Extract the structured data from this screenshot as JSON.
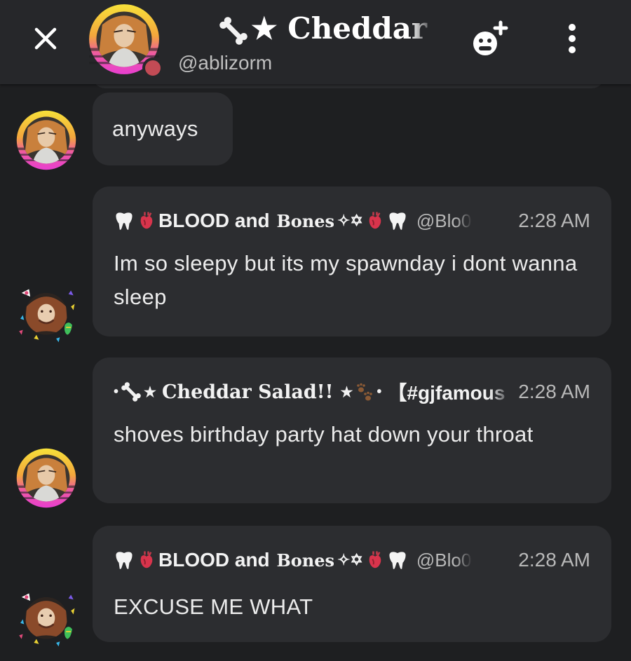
{
  "header": {
    "name": "★ Cheddar Salad!!",
    "handle": "@ablizorm",
    "icons": {
      "close": "close-icon",
      "add_member": "add-member-icon",
      "more": "more-vertical-icon"
    },
    "status_color": "#c24b55"
  },
  "messages": [
    {
      "id": "m1",
      "text": "anyways"
    },
    {
      "id": "m2",
      "sender_prefix": "BLOOD and ",
      "sender_gothic": "Bones",
      "handle": "@Blo0",
      "time": "2:28 AM",
      "text": "Im so sleepy but its my spawnday i dont wanna sleep"
    },
    {
      "id": "m3",
      "sender": "Cheddar Salad!!",
      "tag": "【#gjfamous",
      "time": "2:28 AM",
      "text": "shoves birthday party hat down your throat"
    },
    {
      "id": "m4",
      "sender_prefix": "BLOOD and ",
      "sender_gothic": "Bones",
      "handle": "@Blo0",
      "time": "2:28 AM",
      "text": "EXCUSE ME WHAT"
    }
  ],
  "colors": {
    "background": "#1e1f21",
    "header": "#26272a",
    "bubble": "#2c2d30",
    "text": "#ececec",
    "muted": "#b8b8b8"
  }
}
